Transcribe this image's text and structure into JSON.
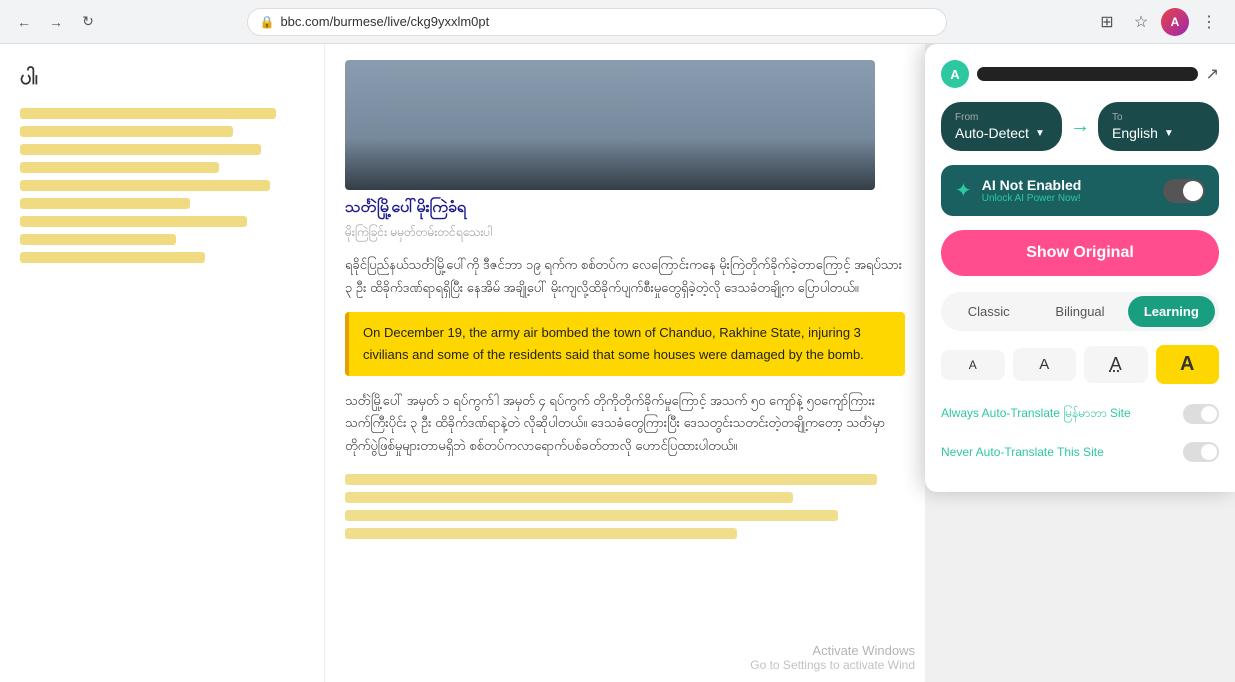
{
  "browser": {
    "url": "bbc.com/burmese/live/ckg9yxxlm0pt",
    "back_label": "←",
    "forward_label": "→",
    "refresh_label": "↺"
  },
  "left_col": {
    "top_text": "ပါ၊",
    "lines": [
      70,
      90,
      85,
      75,
      88,
      60,
      80,
      50
    ]
  },
  "article": {
    "image_alt": "article image",
    "burmese_header": "သင်္တဲမြို့ပေါ်မိုးကြဲခံရ",
    "burmese_subheader": "မိုးကြဲခြင်း မမှတ်တမ်းတင်ရသေးပါ",
    "burmese_body_1": "ရခိုင်ပြည်နယ်သင်္တဲမြို့ပေါ်ကို ဒီဇင်ဘာ ၁၉ ရက်က စစ်တပ်က လေကြောင်းကနေ မိုးကြဲတိုက်ခိုက်ခဲ့တာကြောင့် အရပ်သား ၃ ဦး ထိခိုက်ဒဏ်ရာရရှိပြီး နေအိမ် အချို့ပေါ် မိုးကျလို့ထိခိုက်ပျက်စီးမှုတွေရှိခဲ့တဲ့လို ဒေသခံတချို့က ပြောပါတယ်။",
    "highlighted_text": "On December 19, the army air bombed the town of Chanduo, Rakhine State, injuring 3 civilians and some of the residents said that some houses were damaged by the bomb.",
    "burmese_body_2": "သင်္တဲမြို့ပေါ် အမှတ် ၁ ရပ်ကွက်ါ အမှတ် ၄ ရပ်ကွက် တိုကိုတိုက်ခိုက်မှုကြောင့် အသက် ၅၀ ကျော်နဲ့ ၅၀ကျော်ကြားး သက်ကြီးပိုင်း ၃ ဦး ထိခိုက်ဒဏ်ရာနဲ့တဲ လိုဆိုပါတယ်။ ဒေသခံတွေကြားပြီး ဒေသတွင်းသတင်းတဲ့တချို့ကတော့ သင်္တဲမှာ တိုက်ပွဲဖြစ်မှုများတာမရှိဘဲ စစ်တပ်ကလာရောက်ပစ်ခတ်တာလို ဟောင်ပြထားပါတယ်။"
  },
  "panel": {
    "avatar_letter": "A",
    "share_icon": "⎋",
    "from_label": "From",
    "from_value": "Auto-Detect",
    "arrow": "→",
    "to_label": "To",
    "to_value": "English",
    "ai_title": "AI Not Enabled",
    "ai_subtitle": "Unlock AI Power Now!",
    "show_original_btn": "Show Original",
    "tabs": [
      {
        "id": "classic",
        "label": "Classic",
        "active": false
      },
      {
        "id": "bilingual",
        "label": "Bilingual",
        "active": false
      },
      {
        "id": "learning",
        "label": "Learning",
        "active": true
      }
    ],
    "font_sizes": [
      {
        "id": "small",
        "label": "A",
        "active": false
      },
      {
        "id": "medium",
        "label": "A",
        "active": false
      },
      {
        "id": "large",
        "label": "A",
        "active": false
      },
      {
        "id": "xlarge",
        "label": "A",
        "active": true
      }
    ],
    "auto_translate_label": "Always Auto-Translate မြန်မာဘာ Site",
    "never_translate_label": "Never Auto-Translate This Site"
  },
  "watermark": {
    "line1": "Activate Windows",
    "line2": "Go to Settings to activate Wind"
  }
}
